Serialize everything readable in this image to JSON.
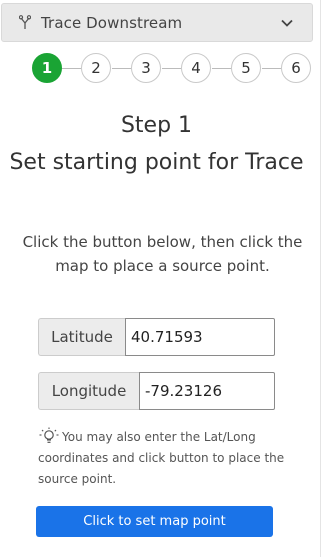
{
  "header": {
    "title": "Trace Downstream",
    "icon": "trace-branch-icon",
    "collapse_icon": "chevron-down-icon"
  },
  "stepper": {
    "active_step": 1,
    "steps": [
      "1",
      "2",
      "3",
      "4",
      "5",
      "6"
    ],
    "active_color": "#1aa434"
  },
  "content": {
    "step_title": "Step 1",
    "step_subtitle": "Set starting point for Trace",
    "instructions": "Click the button below, then click the map to place a source point."
  },
  "fields": {
    "latitude_label": "Latitude",
    "latitude_value": "40.71593",
    "longitude_label": "Longitude",
    "longitude_value": "-79.23126"
  },
  "tip": {
    "icon": "lightbulb-icon",
    "text": "You may also enter the Lat/Long coordinates and click button to place the source point."
  },
  "action": {
    "button_label": "Click to set map point",
    "color": "#1a73e8"
  }
}
